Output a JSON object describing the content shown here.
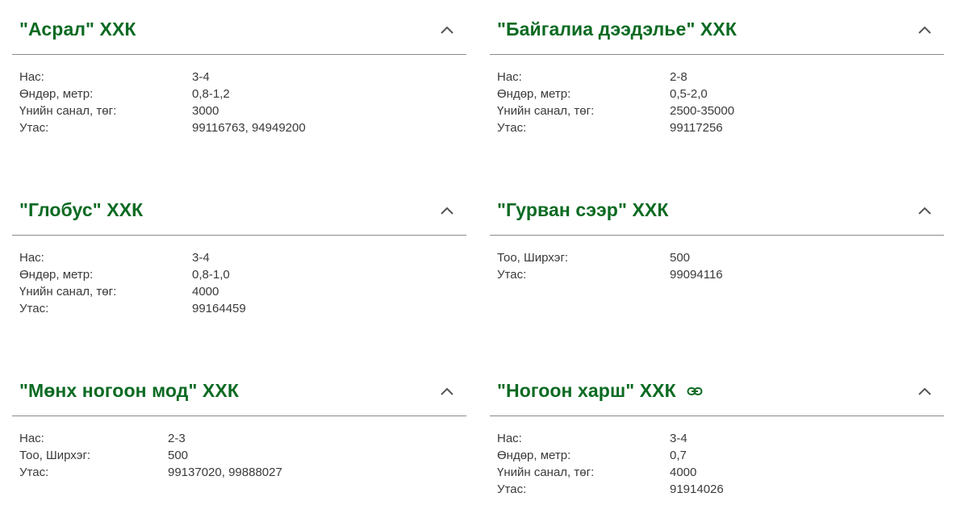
{
  "cards": [
    {
      "title": "\"Асрал\" ХХК",
      "rows": [
        {
          "label": "Нас:",
          "value": "3-4"
        },
        {
          "label": "Өндөр, метр:",
          "value": "0,8-1,2"
        },
        {
          "label": "Үнийн санал, төг:",
          "value": "3000"
        },
        {
          "label": "Утас:",
          "value": "99116763, 94949200"
        }
      ]
    },
    {
      "title": "\"Байгалиа дээдэлье\" ХХК",
      "rows": [
        {
          "label": "Нас:",
          "value": "2-8"
        },
        {
          "label": "Өндөр, метр:",
          "value": "0,5-2,0"
        },
        {
          "label": "Үнийн санал, төг:",
          "value": "2500-35000"
        },
        {
          "label": "Утас:",
          "value": "99117256"
        }
      ]
    },
    {
      "title": "\"Глобус\" ХХК",
      "rows": [
        {
          "label": "Нас:",
          "value": "3-4"
        },
        {
          "label": "Өндөр, метр:",
          "value": "0,8-1,0"
        },
        {
          "label": "Үнийн санал, төг:",
          "value": "4000"
        },
        {
          "label": "Утас:",
          "value": "99164459"
        }
      ]
    },
    {
      "title": "\"Гурван сээр\" ХХК",
      "rows": [
        {
          "label": "Тоо, Ширхэг:",
          "value": "500"
        },
        {
          "label": "Утас:",
          "value": "99094116"
        }
      ]
    },
    {
      "title": "\"Мөнх ногоон мод\" ХХК",
      "rows": [
        {
          "label": "Нас:",
          "value": "2-3"
        },
        {
          "label": "Тоо, Ширхэг:",
          "value": "500"
        },
        {
          "label": "Утас:",
          "value": "99137020, 99888027"
        }
      ]
    },
    {
      "title": "\"Ногоон харш\" ХХК",
      "rows": [
        {
          "label": "Нас:",
          "value": "3-4"
        },
        {
          "label": "Өндөр, метр:",
          "value": "0,7"
        },
        {
          "label": "Үнийн санал, төг:",
          "value": "4000"
        },
        {
          "label": "Утас:",
          "value": "91914026"
        }
      ]
    }
  ],
  "colors": {
    "title": "#0b6a22",
    "text": "#3a3a3a",
    "divider": "#8a8a8a",
    "chevron": "#555555"
  },
  "icons": {
    "collapse": "chevron-up-icon",
    "link": "link-icon"
  }
}
